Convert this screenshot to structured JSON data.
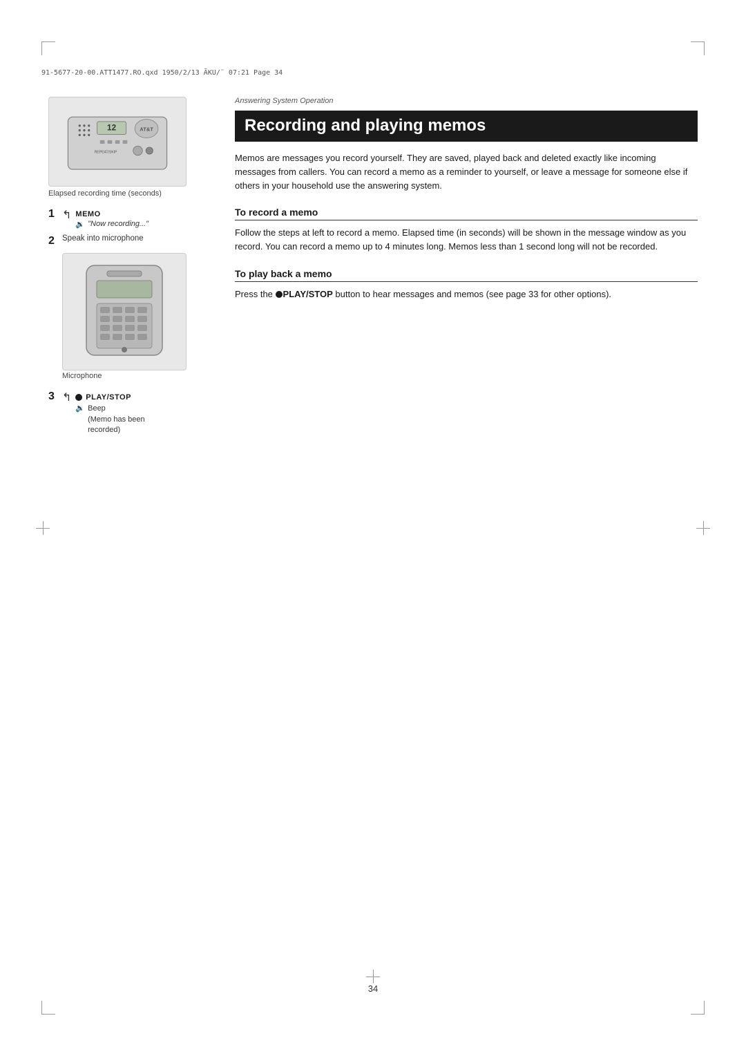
{
  "header": {
    "text": "91-5677-20-00.ATT1477.RO.qxd   1950/2/13   ÃKU/¨   07:21   Page 34"
  },
  "page_number": "34",
  "section_label": "Answering System Operation",
  "section_title": "Recording and playing memos",
  "intro_text": "Memos are messages you record yourself. They are saved, played back and deleted exactly like incoming messages from callers. You can record a memo as a reminder to yourself, or leave a message for someone else if others in your household use the answering system.",
  "elapsed_label": "Elapsed recording time (seconds)",
  "microphone_label": "Microphone",
  "steps": [
    {
      "number": "1",
      "button": "MEMO",
      "sub_text": "\"Now recording...\""
    },
    {
      "number": "2",
      "desc": "Speak into microphone"
    },
    {
      "number": "3",
      "button": "PLAY/STOP",
      "sub_texts": [
        "Beep",
        "(Memo has been recorded)"
      ]
    }
  ],
  "subsections": [
    {
      "title": "To record a memo",
      "body": "Follow the steps at left to record a memo. Elapsed time (in seconds) will be shown in the message window as you record. You can record a memo up to 4 minutes long. Memos less than 1 second long will not be recorded."
    },
    {
      "title": "To play back a memo",
      "body_start": "Press the ",
      "body_bold": "PLAY/STOP",
      "body_end": " button to hear messages and memos (see page 33 for other options)."
    }
  ]
}
